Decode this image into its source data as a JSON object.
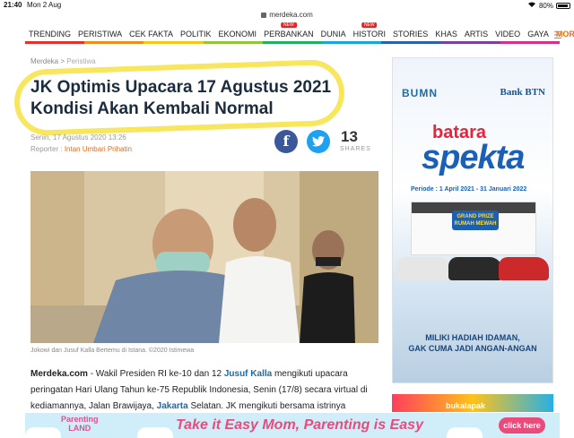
{
  "status": {
    "time": "21:40",
    "date": "Mon 2 Aug",
    "battery": "80%"
  },
  "browser": {
    "domain": "merdeka.com"
  },
  "nav": {
    "items": [
      {
        "label": "TRENDING",
        "new": false
      },
      {
        "label": "PERISTIWA",
        "new": false
      },
      {
        "label": "CEK FAKTA",
        "new": false
      },
      {
        "label": "POLITIK",
        "new": false
      },
      {
        "label": "EKONOMI",
        "new": false
      },
      {
        "label": "PERBANKAN",
        "new": true
      },
      {
        "label": "DUNIA",
        "new": false
      },
      {
        "label": "HISTORI",
        "new": true
      },
      {
        "label": "STORIES",
        "new": false
      },
      {
        "label": "KHAS",
        "new": false
      },
      {
        "label": "ARTIS",
        "new": false
      },
      {
        "label": "VIDEO",
        "new": false
      },
      {
        "label": "GAYA",
        "new": false
      }
    ],
    "more_label": "MORE",
    "new_tag": "NEW",
    "color_stripes": [
      "#e7302a",
      "#f28c1f",
      "#f7c518",
      "#8dc63f",
      "#1fb25a",
      "#19a6d9",
      "#2b5fb4",
      "#7a3fa0",
      "#d62f8c"
    ]
  },
  "article": {
    "breadcrumb_home": "Merdeka",
    "breadcrumb_sep": ">",
    "breadcrumb_section": "Peristiwa",
    "title": "JK Optimis Upacara 17 Agustus 2021 Kondisi Akan Kembali Normal",
    "date": "Senin, 17 Agustus 2020 13:26",
    "reporter_label": "Reporter :",
    "reporter_name": "Intan Umbari Prihatin",
    "share_count": "13",
    "share_label": "SHARES",
    "photo_caption": "Jokowi dan Jusuf Kalla Bertemu di Istana. ©2020 Istimewa",
    "body": {
      "lead": "Merdeka.com",
      "p1": " - Wakil Presiden RI ke-10 dan 12 ",
      "link1": "Jusuf Kalla",
      "p2": " mengikuti upacara peringatan Hari Ulang Tahun ke-75 Republik Indonesia, Senin (17/8) secara virtual di kediamannya, Jalan Brawijaya, ",
      "link2": "Jakarta",
      "p3": " Selatan. JK mengikuti bersama istrinya"
    }
  },
  "ad_right": {
    "bumn": "BUMN",
    "bank": "Bank BTN",
    "batara": "batara",
    "spekta": "spekta",
    "periode": "Periode : 1 April 2021 - 31 Januari 2022",
    "prize": "GRAND PRIZE RUMAH MEWAH",
    "miliki_1": "MILIKI HADIAH IDAMAN,",
    "miliki_2": "GAK CUMA JADI ANGAN-ANGAN"
  },
  "ad_right2": {
    "brand": "bukalapak"
  },
  "banner": {
    "logo_line1": "Parenting",
    "logo_line2": "LAND",
    "headline": "Take it Easy Mom, Parenting is Easy",
    "cta": "click here"
  }
}
